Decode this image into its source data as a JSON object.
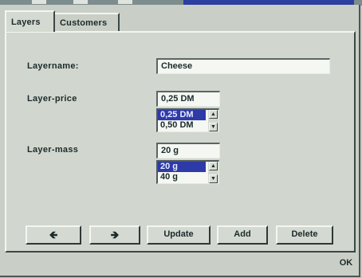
{
  "tabs": [
    {
      "label": "Layers"
    },
    {
      "label": "Customers"
    }
  ],
  "form": {
    "layername": {
      "label": "Layername:",
      "value": "Cheese"
    },
    "layer_price": {
      "label": "Layer-price",
      "value": "0,25 DM",
      "options": [
        "0,25 DM",
        "0,50 DM"
      ],
      "selected": "0,25 DM"
    },
    "layer_mass": {
      "label": "Layer-mass",
      "value": "20 g",
      "options": [
        "20 g",
        "40 g"
      ],
      "selected": "20 g"
    }
  },
  "buttons": {
    "prev_icon": "left-arrow-icon",
    "next_icon": "right-arrow-icon",
    "update": "Update",
    "add": "Add",
    "delete": "Delete",
    "ok": "OK"
  },
  "icons": {
    "scroll_up": "scroll-up-arrow-icon",
    "scroll_down": "scroll-down-arrow-icon"
  },
  "colors": {
    "selection": "#2e3aa8",
    "titlebar": "#2a3fa0"
  }
}
